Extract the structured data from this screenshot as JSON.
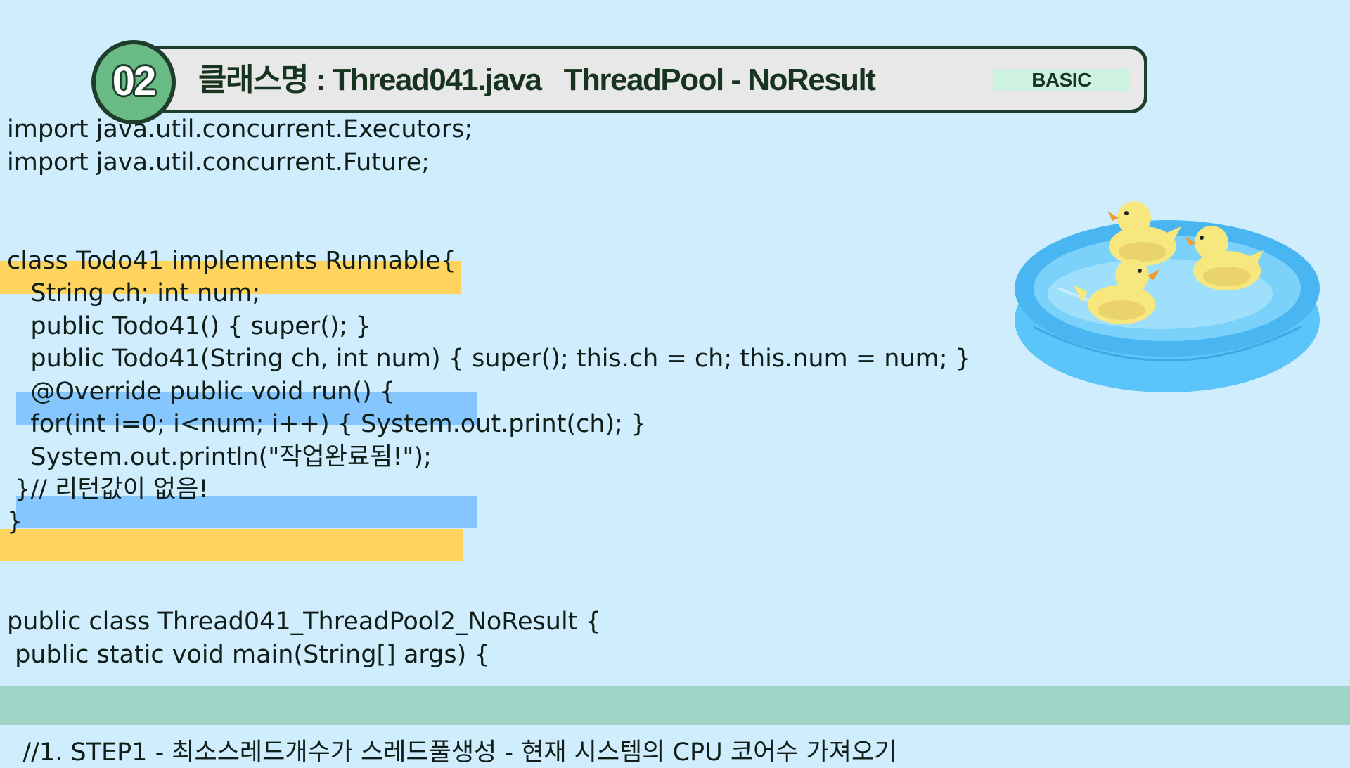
{
  "header": {
    "number": "02",
    "title": "클래스명 : Thread041.java   ThreadPool - NoResult",
    "badge": "BASIC"
  },
  "code": {
    "lines": [
      "import java.util.concurrent.Executors;",
      "import java.util.concurrent.Future;",
      "class Todo41 implements Runnable{",
      "   String ch; int num;",
      "   public Todo41() { super(); }",
      "   public Todo41(String ch, int num) { super(); this.ch = ch; this.num = num; }",
      "   @Override public void run() {",
      "   for(int i=0; i<num; i++) { System.out.print(ch); }",
      "   System.out.println(\"작업완료됨!\");",
      " }// 리턴값이 없음!",
      "}",
      "public class Thread041_ThreadPool2_NoResult {",
      " public static void main(String[] args) {",
      "  //1. STEP1 - 최소스레드개수가 스레드풀생성 - 현재 시스템의 CPU 코어수 가져오기"
    ]
  },
  "colors": {
    "background": "#d0edfd",
    "highlight_yellow": "#fed45f",
    "highlight_blue": "#84c6fd",
    "band_green": "#9fd4c6",
    "badge_circle": "#6aba86"
  },
  "illustration": {
    "icon": "rubber-ducks-in-pool-icon"
  }
}
